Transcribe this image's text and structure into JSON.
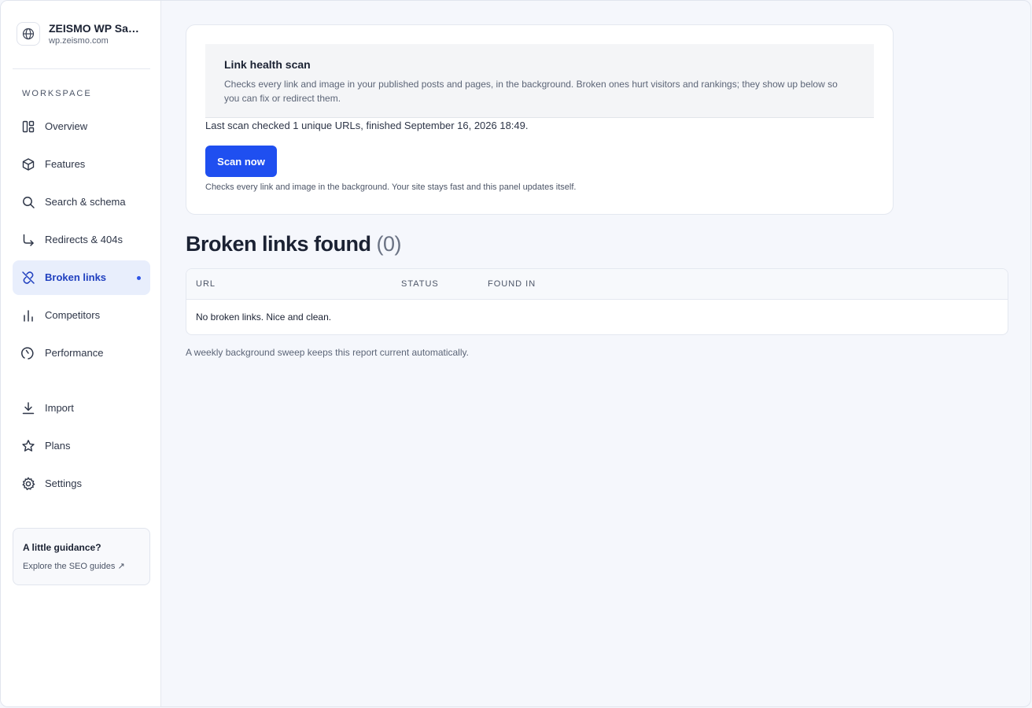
{
  "site": {
    "name": "ZEISMO WP Sandbox",
    "url": "wp.zeismo.com",
    "icon": "globe-icon"
  },
  "sidebar": {
    "section_label": "WORKSPACE",
    "items": [
      {
        "label": "Overview",
        "icon": "dashboard-icon"
      },
      {
        "label": "Features",
        "icon": "cube-icon"
      },
      {
        "label": "Search & schema",
        "icon": "search-icon"
      },
      {
        "label": "Redirects & 404s",
        "icon": "redirect-arrow-icon"
      },
      {
        "label": "Broken links",
        "icon": "broken-link-icon",
        "active": true
      },
      {
        "label": "Competitors",
        "icon": "bar-chart-icon"
      },
      {
        "label": "Performance",
        "icon": "gauge-icon"
      },
      {
        "label": "Import",
        "icon": "download-icon"
      },
      {
        "label": "Plans",
        "icon": "star-icon"
      },
      {
        "label": "Settings",
        "icon": "gear-icon"
      }
    ],
    "guide": {
      "title": "A little guidance?",
      "link": "Explore the SEO guides ↗"
    }
  },
  "scan": {
    "title": "Link health scan",
    "description": "Checks every link and image in your published posts and pages, in the background. Broken ones hurt visitors and rankings; they show up below so you can fix or redirect them.",
    "last_scan": "Last scan checked 1 unique URLs, finished September 16, 2026 18:49.",
    "button_label": "Scan now",
    "hint": "Checks every link and image in the background. Your site stays fast and this panel updates itself."
  },
  "broken": {
    "heading": "Broken links found",
    "count": "(0)",
    "columns": [
      "URL",
      "STATUS",
      "FOUND IN"
    ],
    "empty": "No broken links. Nice and clean.",
    "footer": "A weekly background sweep keeps this report current automatically."
  },
  "colors": {
    "accent": "#1f4ff0",
    "active_bg": "#e8eefc",
    "background": "#f5f7fc"
  }
}
